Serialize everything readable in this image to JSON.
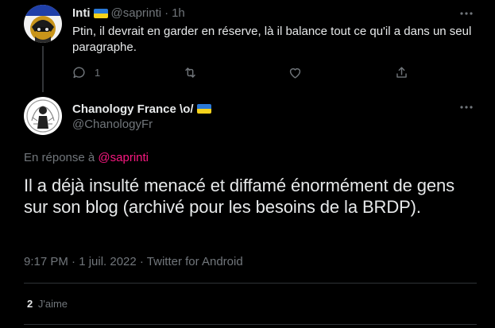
{
  "reply_tweet": {
    "name": "Inti",
    "handle": "@saprinti",
    "separator": "·",
    "time": "1h",
    "text": "Ptin, il devrait en garder en réserve, là il balance tout ce qu'il a dans un seul paragraphe.",
    "reply_count": "1",
    "flag_icon": "ukraine-flag-icon"
  },
  "main_tweet": {
    "name": "Chanology France \\o/",
    "handle": "@ChanologyFr",
    "in_reply_prefix": "En réponse à",
    "in_reply_mention": "@saprinti",
    "text": "Il a déjà insulté menacé et diffamé énormément de gens sur son blog (archivé pour les besoins de la BRDP).",
    "meta": "9:17 PM · 1 juil. 2022 · Twitter for Android",
    "likes_count": "2",
    "likes_label": "J'aime"
  },
  "colors": {
    "background": "#000000",
    "text_primary": "#e7e9ea",
    "text_secondary": "#71767b",
    "mention": "#f91880",
    "divider": "#2f3336",
    "flag_blue": "#2a78d6",
    "flag_yellow": "#f5d21c"
  }
}
